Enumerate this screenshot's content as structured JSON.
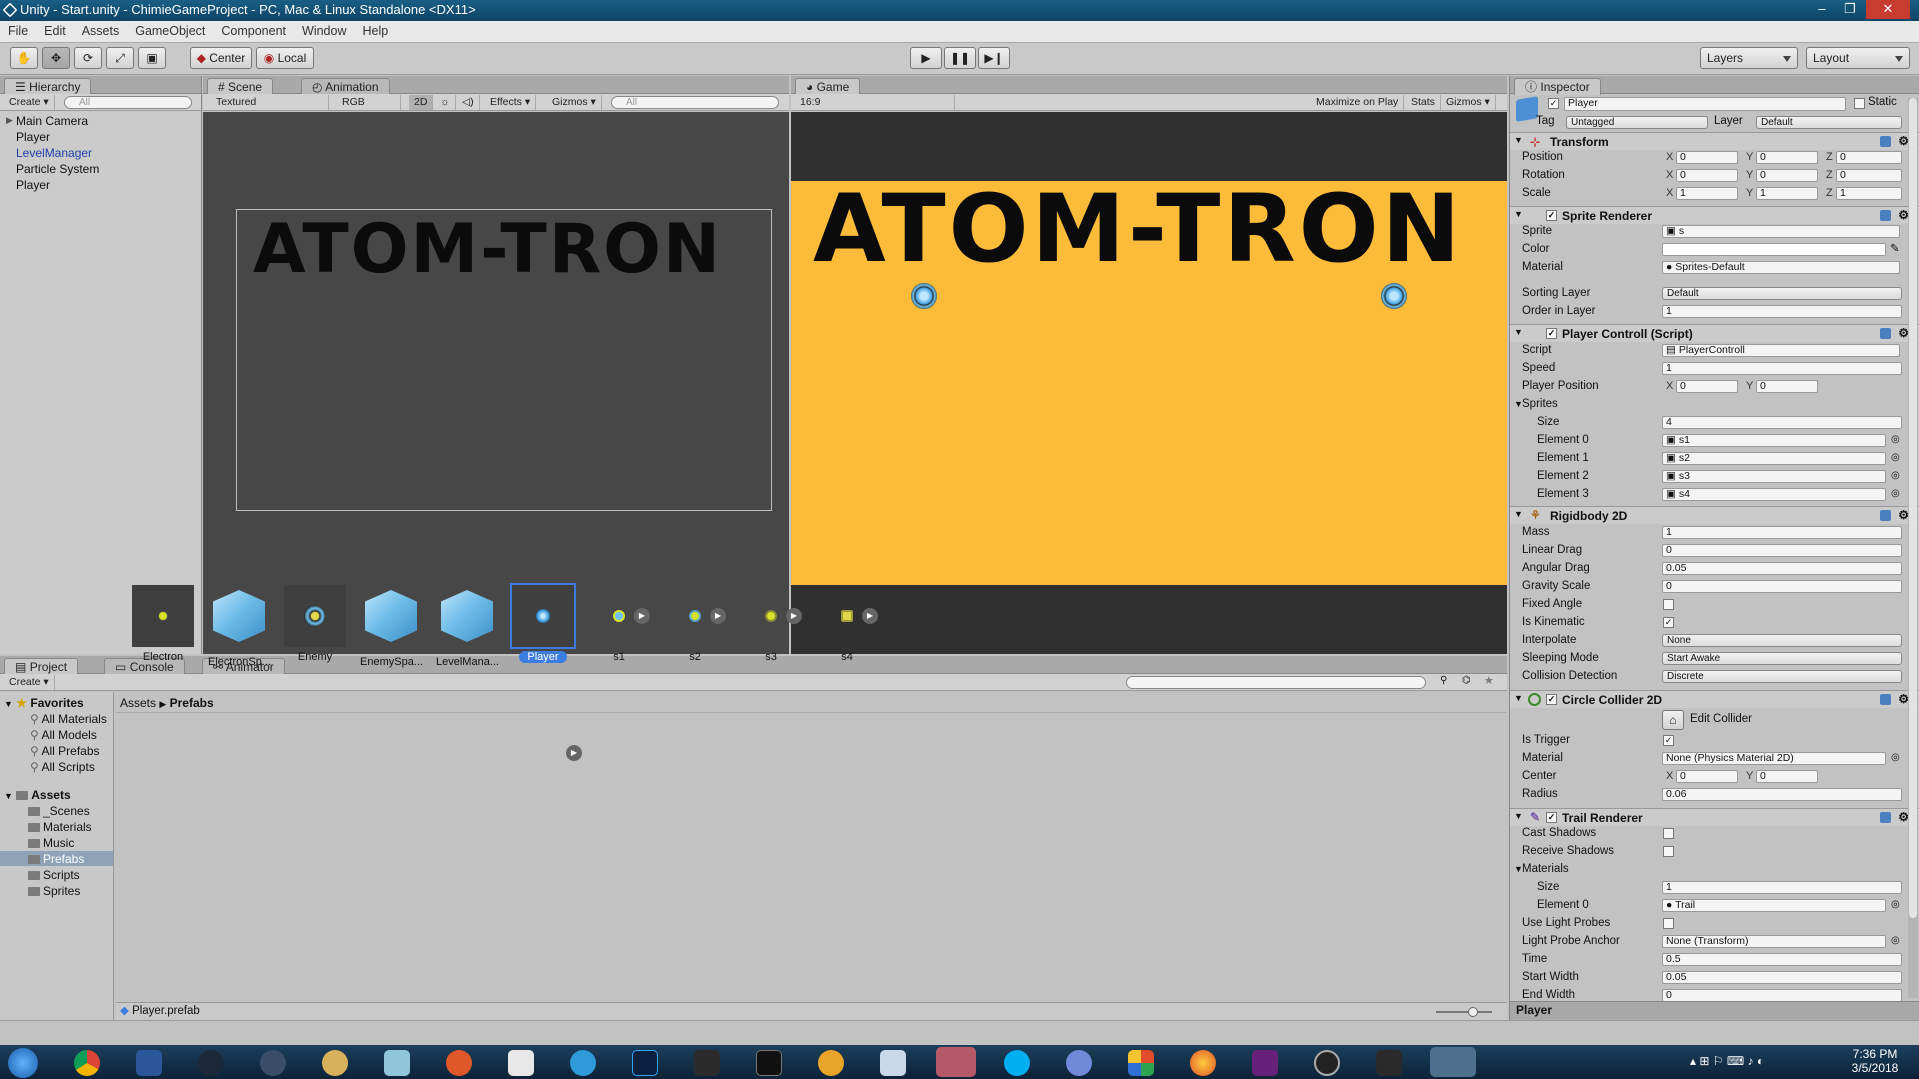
{
  "window": {
    "title": "Unity - Start.unity - ChimieGameProject - PC, Mac & Linux Standalone <DX11>",
    "min": "‒",
    "max": "❐",
    "close": "✕"
  },
  "menu": [
    "File",
    "Edit",
    "Assets",
    "GameObject",
    "Component",
    "Window",
    "Help"
  ],
  "toolbar": {
    "center": "Center",
    "local": "Local",
    "layers": "Layers",
    "layout": "Layout"
  },
  "hierarchy": {
    "tab": "Hierarchy",
    "create": "Create",
    "search_placeholder": "All",
    "items": [
      {
        "label": "Main Camera",
        "color": "#111111"
      },
      {
        "label": "Player",
        "color": "#111111"
      },
      {
        "label": "LevelManager",
        "color": "#1c3fa8"
      },
      {
        "label": "Particle System",
        "color": "#111111"
      },
      {
        "label": "Player",
        "color": "#111111"
      }
    ]
  },
  "scene": {
    "tab": "Scene",
    "tab2": "Animation",
    "shading": "Textured",
    "rgb": "RGB",
    "mode2d": "2D",
    "effects": "Effects",
    "gizmos": "Gizmos",
    "search_placeholder": "All",
    "logo_text": "ATOM-TRON"
  },
  "game": {
    "tab": "Game",
    "aspect": "16:9",
    "maximize": "Maximize on Play",
    "stats": "Stats",
    "gizmos": "Gizmos",
    "logo_text": "ATOM-TRON",
    "bg_color": "#fdbb3a"
  },
  "inspector": {
    "tab": "Inspector",
    "object_name": "Player",
    "static_label": "Static",
    "tag_label": "Tag",
    "tag_value": "Untagged",
    "layer_label": "Layer",
    "layer_value": "Default",
    "transform": {
      "title": "Transform",
      "position_label": "Position",
      "position": [
        "0",
        "0",
        "0"
      ],
      "rotation_label": "Rotation",
      "rotation": [
        "0",
        "0",
        "0"
      ],
      "scale_label": "Scale",
      "scale": [
        "1",
        "1",
        "1"
      ]
    },
    "sprite_renderer": {
      "title": "Sprite Renderer",
      "sprite_label": "Sprite",
      "sprite": "s",
      "color_label": "Color",
      "material_label": "Material",
      "material": "Sprites-Default",
      "sorting_layer_label": "Sorting Layer",
      "sorting_layer": "Default",
      "order_label": "Order in Layer",
      "order": "1"
    },
    "player_controll": {
      "title": "Player Controll (Script)",
      "script_label": "Script",
      "script": "PlayerControll",
      "speed_label": "Speed",
      "speed": "1",
      "player_position_label": "Player Position",
      "player_position": [
        "0",
        "0"
      ],
      "sprites_label": "Sprites",
      "size_label": "Size",
      "size": "4",
      "elements": [
        {
          "label": "Element 0",
          "value": "s1"
        },
        {
          "label": "Element 1",
          "value": "s2"
        },
        {
          "label": "Element 2",
          "value": "s3"
        },
        {
          "label": "Element 3",
          "value": "s4"
        }
      ]
    },
    "rigidbody": {
      "title": "Rigidbody 2D",
      "mass_label": "Mass",
      "mass": "1",
      "linear_drag_label": "Linear Drag",
      "linear_drag": "0",
      "angular_drag_label": "Angular Drag",
      "angular_drag": "0.05",
      "gravity_label": "Gravity Scale",
      "gravity": "0",
      "fixed_angle_label": "Fixed Angle",
      "kinematic_label": "Is Kinematic",
      "interpolate_label": "Interpolate",
      "interpolate": "None",
      "sleeping_label": "Sleeping Mode",
      "sleeping": "Start Awake",
      "collision_label": "Collision Detection",
      "collision": "Discrete"
    },
    "circle_collider": {
      "title": "Circle Collider 2D",
      "edit_label": "Edit Collider",
      "trigger_label": "Is Trigger",
      "material_label": "Material",
      "material": "None (Physics Material 2D)",
      "center_label": "Center",
      "center": [
        "0",
        "0"
      ],
      "radius_label": "Radius",
      "radius": "0.06"
    },
    "trail_renderer": {
      "title": "Trail Renderer",
      "cast_label": "Cast Shadows",
      "receive_label": "Receive Shadows",
      "materials_label": "Materials",
      "size_label": "Size",
      "size": "1",
      "element0_label": "Element 0",
      "element0": "Trail",
      "light_probes_label": "Use Light Probes",
      "anchor_label": "Light Probe Anchor",
      "anchor": "None (Transform)",
      "time_label": "Time",
      "time": "0.5",
      "start_label": "Start Width",
      "start": "0.05",
      "end_label": "End Width",
      "end": "0"
    },
    "footer": "Player"
  },
  "project": {
    "tab": "Project",
    "tab2": "Console",
    "tab3": "Animator",
    "create": "Create",
    "favorites": "Favorites",
    "fav_items": [
      "All Materials",
      "All Models",
      "All Prefabs",
      "All Scripts"
    ],
    "assets": "Assets",
    "folders": [
      "_Scenes",
      "Materials",
      "Music",
      "Prefabs",
      "Scripts",
      "Sprites"
    ],
    "breadcrumb": [
      "Assets",
      "Prefabs"
    ],
    "items": [
      "Electron",
      "ElectronSp...",
      "Enemy",
      "EnemySpa...",
      "LevelMana...",
      "Player",
      "s1",
      "s2",
      "s3",
      "s4"
    ],
    "footer": "Player.prefab"
  },
  "taskbar": {
    "time": "7:36 PM",
    "date": "3/5/2018"
  }
}
